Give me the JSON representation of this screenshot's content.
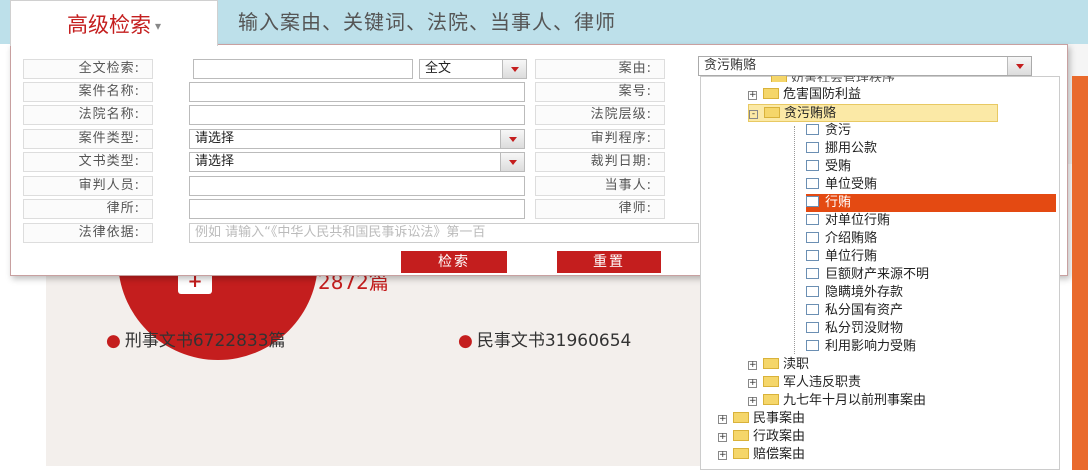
{
  "header": {
    "adv_tab": "高级检索",
    "search_hint": "输入案由、关键词、法院、当事人、律师"
  },
  "form": {
    "fulltext_label": "全文检索:",
    "fulltext_scope": "全文",
    "case_name_label": "案件名称:",
    "court_name_label": "法院名称:",
    "case_type_label": "案件类型:",
    "case_type_value": "请选择",
    "doc_type_label": "文书类型:",
    "doc_type_value": "请选择",
    "judge_label": "审判人员:",
    "law_firm_label": "律所:",
    "legal_basis_label": "法律依据:",
    "legal_basis_placeholder": "例如  请输入“《中华人民共和国民事诉讼法》第一百",
    "cause_label": "案由:",
    "case_no_label": "案号:",
    "court_level_label": "法院层级:",
    "procedure_label": "审判程序:",
    "judgment_date_label": "裁判日期:",
    "party_label": "当事人:",
    "lawyer_label": "律师:",
    "search_btn": "检索",
    "reset_btn": "重置"
  },
  "tree": {
    "selected_value": "贪污贿赂",
    "partial_top": "妨害社会管理秩序",
    "nodes": [
      {
        "label": "危害国防利益",
        "kind": "folder",
        "expand": "+"
      },
      {
        "label": "贪污贿赂",
        "kind": "folder",
        "expand": "-"
      },
      {
        "label": "贪污",
        "kind": "doc"
      },
      {
        "label": "挪用公款",
        "kind": "doc"
      },
      {
        "label": "受贿",
        "kind": "doc"
      },
      {
        "label": "单位受贿",
        "kind": "doc"
      },
      {
        "label": "行贿",
        "kind": "doc"
      },
      {
        "label": "对单位行贿",
        "kind": "doc"
      },
      {
        "label": "介绍贿赂",
        "kind": "doc"
      },
      {
        "label": "单位行贿",
        "kind": "doc"
      },
      {
        "label": "巨额财产来源不明",
        "kind": "doc"
      },
      {
        "label": "隐瞒境外存款",
        "kind": "doc"
      },
      {
        "label": "私分国有资产",
        "kind": "doc"
      },
      {
        "label": "私分罚没财物",
        "kind": "doc"
      },
      {
        "label": "利用影响力受贿",
        "kind": "doc"
      },
      {
        "label": "渎职",
        "kind": "folder",
        "expand": "+"
      },
      {
        "label": "军人违反职责",
        "kind": "folder",
        "expand": "+"
      },
      {
        "label": "九七年十月以前刑事案由",
        "kind": "folder",
        "expand": "+"
      },
      {
        "label": "民事案由",
        "kind": "folder",
        "expand": "+"
      },
      {
        "label": "行政案由",
        "kind": "folder",
        "expand": "+"
      },
      {
        "label": "赔偿案由",
        "kind": "folder",
        "expand": "+"
      }
    ]
  },
  "background": {
    "count_text": "2872篇",
    "criminal_stat": "刑事文书6722833篇",
    "civil_stat": "民事文书31960654"
  }
}
